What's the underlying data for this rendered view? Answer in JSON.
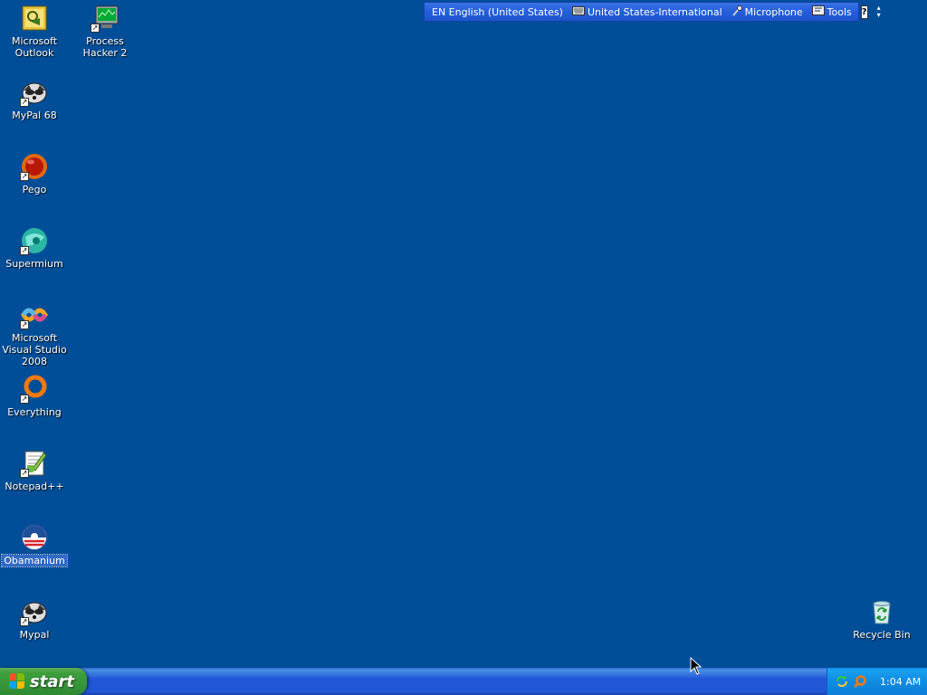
{
  "desktop": {
    "background_color": "#004E98",
    "icons": [
      {
        "label": "Microsoft Outlook",
        "icon": "outlook-icon",
        "shortcut": false
      },
      {
        "label": "Process Hacker 2",
        "icon": "process-hacker-icon",
        "shortcut": true
      },
      {
        "label": "MyPal 68",
        "icon": "mypal-icon",
        "shortcut": true
      },
      {
        "label": "Pego",
        "icon": "pego-icon",
        "shortcut": true
      },
      {
        "label": "Supermium",
        "icon": "supermium-icon",
        "shortcut": true
      },
      {
        "label": "Microsoft Visual Studio 2008",
        "icon": "visual-studio-icon",
        "shortcut": true
      },
      {
        "label": "Everything",
        "icon": "everything-icon",
        "shortcut": true
      },
      {
        "label": "Notepad++",
        "icon": "notepadpp-icon",
        "shortcut": true
      },
      {
        "label": "Obamanium",
        "icon": "obamanium-icon",
        "shortcut": false,
        "selected": true
      },
      {
        "label": "Mypal",
        "icon": "mypal-icon",
        "shortcut": true
      },
      {
        "label": "Recycle Bin",
        "icon": "recycle-bin-icon",
        "shortcut": false
      }
    ]
  },
  "language_bar": {
    "language": "EN English (United States)",
    "keyboard": "United States-International",
    "microphone": "Microphone",
    "tools": "Tools",
    "help": "?"
  },
  "taskbar": {
    "start_label": "start",
    "clock": "1:04 AM",
    "tray_icons": [
      "network-refresh-icon",
      "search-magnifier-icon"
    ]
  }
}
